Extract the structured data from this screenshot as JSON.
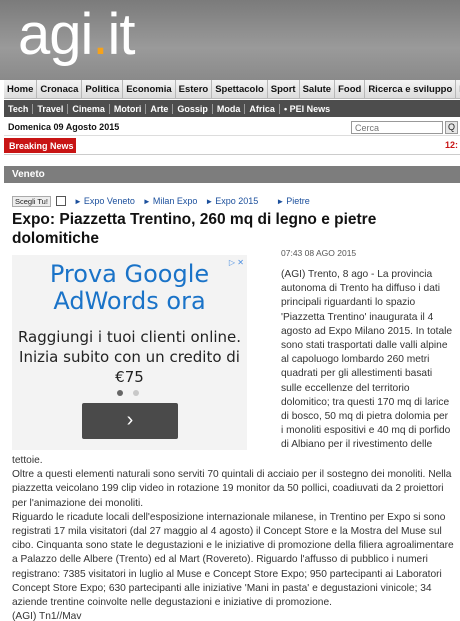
{
  "logo": {
    "main": "agi",
    "dot": ".",
    "tld": "it"
  },
  "nav_main": [
    "Home",
    "Cronaca",
    "Politica",
    "Economia",
    "Estero",
    "Spettacolo",
    "Sport",
    "Salute",
    "Food",
    "Ricerca e sviluppo",
    "Ne"
  ],
  "nav_sub": [
    "Tech",
    "Travel",
    "Cinema",
    "Motori",
    "Arte",
    "Gossip",
    "Moda",
    "Africa",
    "• PEI News"
  ],
  "date": "Domenica 09 Agosto 2015",
  "search": {
    "placeholder": "Cerca",
    "button": "Q"
  },
  "breaking": {
    "label": "Breaking News",
    "time": "12:"
  },
  "section": "Veneto",
  "tools": {
    "pick_label": "Scegli Tu!"
  },
  "tags": [
    "Expo Veneto",
    "Milan Expo",
    "Expo 2015",
    "Pietre"
  ],
  "article": {
    "title": "Expo: Piazzetta Trentino, 260 mq di legno e pietre dolomitiche",
    "timestamp": "07:43 08 AGO 2015",
    "intro": "(AGI) Trento, 8 ago - La provincia autonoma di Trento ha diffuso i dati principali riguardanti lo spazio 'Piazzetta Trentino' inaugurata il 4 agosto ad Expo Milano 2015. In totale sono stati trasportati dalle valli alpine al capoluogo lombardo 260 metri quadrati per gli allestimenti basati sulle eccellenze del territorio dolomitico; tra questi 170 mq di larice di bosco, 50 mq di pietra dolomia per i monoliti espositivi e 40 mq di porfido di Albiano per il rivestimento delle",
    "p1_tail": "tettoie.",
    "p2": "  Oltre a questi elementi naturali sono serviti 70 quintali di acciaio per il sostegno dei monoliti. Nella piazzetta veicolano 199 clip video in rotazione 19 monitor da 50 pollici, coadiuvati da 2 proiettori per l'animazione dei monoliti.",
    "p3": "  Riguardo le ricadute locali dell'esposizione internazionale milanese, in Trentino per Expo si sono registrati 17 mila visitatori (dal 27 maggio al 4 agosto) il Concept Store e la Mostra del Muse sul cibo. Cinquanta sono state le degustazioni e le iniziative di promozione della filiera agroalimentare a Palazzo delle Albere (Trento) ed al Mart (Rovereto). Riguardo l'affusso di pubblico i numeri registrano: 7385 visitatori in luglio al Muse e Concept Store Expo; 950 partecipanti ai Laboratori Concept Store Expo; 630 partecipanti alle iniziative 'Mani in pasta' e degustazioni vinicole; 34 aziende trentine coinvolte nelle degustazioni e iniziative di promozione.",
    "signature": "(AGI) Tn1//Mav"
  },
  "ad": {
    "close": "▷ ✕",
    "headline": "Prova Google AdWords ora",
    "body": "Raggiungi i tuoi clienti online. Inizia subito con un credito di €75",
    "button": "›",
    "dot_active": "#666666",
    "dot_inactive": "#c8c8c8"
  }
}
